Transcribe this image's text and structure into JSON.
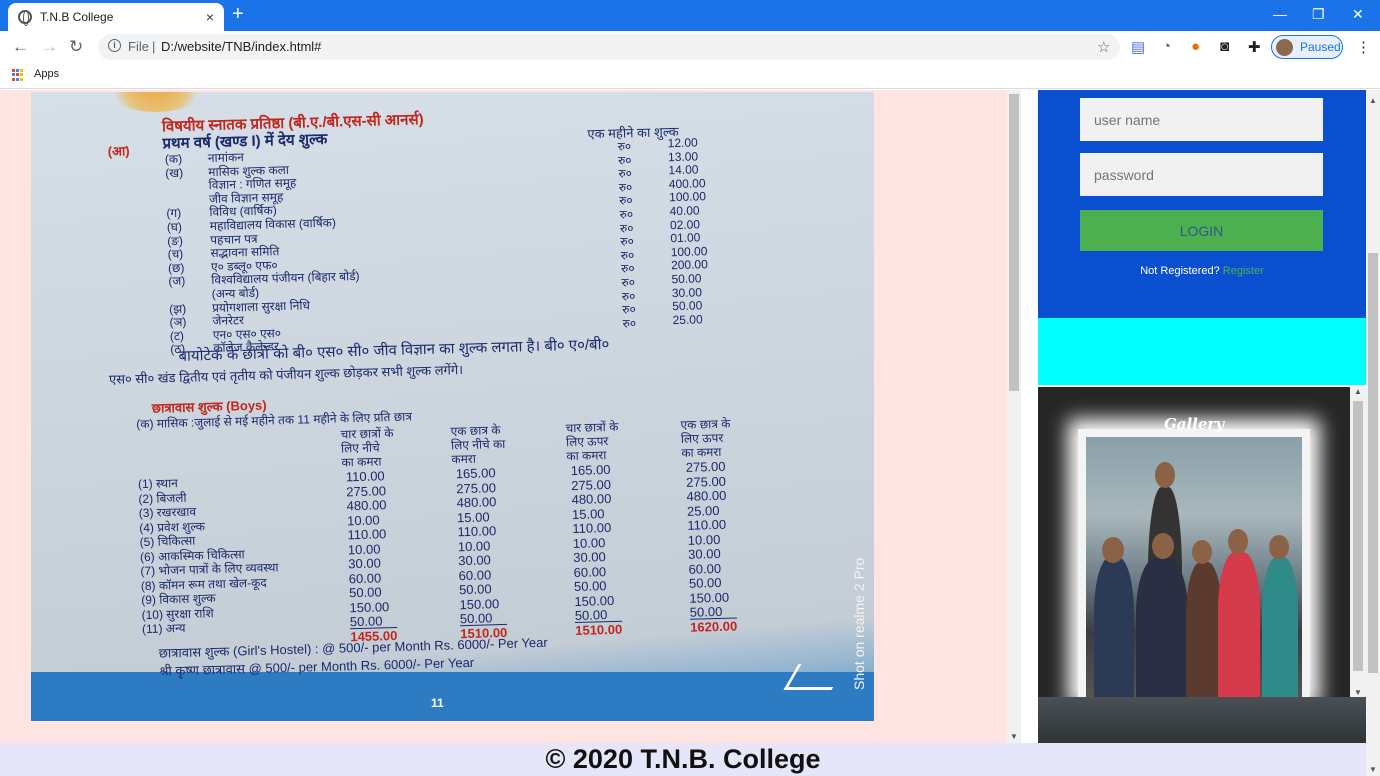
{
  "browser": {
    "tab_title": "T.N.B College",
    "tab_close": "×",
    "new_tab": "+",
    "url_scheme": "File",
    "url": "D:/website/TNB/index.html#",
    "profile_status": "Paused",
    "bookmark_apps": "Apps",
    "min": "—",
    "restore": "❐",
    "close": "✕"
  },
  "login": {
    "username_placeholder": "user name",
    "password_placeholder": "password",
    "login_label": "LOGIN",
    "not_registered": "Not Registered?",
    "register_link": "Register"
  },
  "gallery": {
    "title": "Gallery"
  },
  "footer": {
    "copyright": "© 2020 T.N.B. College"
  },
  "document": {
    "heading_marker": "(आ)",
    "heading": "विषयीय स्नातक प्रतिष्ठा (बी.ए./बी.एस-सी आनर्स)",
    "subheading": "प्रथम वर्ष (खण्ड I) में देय शुल्क",
    "fee_col": "एक महीने का शुल्क",
    "fees": [
      {
        "m": "(क)",
        "l": "नामांकन",
        "c": "रु०",
        "v": "12.00"
      },
      {
        "m": "(ख)",
        "l": "मासिक शुल्क कला",
        "c": "रु०",
        "v": "13.00"
      },
      {
        "m": "",
        "l": "विज्ञान : गणित समूह",
        "c": "रु०",
        "v": "14.00"
      },
      {
        "m": "",
        "l": "जीव विज्ञान समूह",
        "c": "रु०",
        "v": "400.00"
      },
      {
        "m": "(ग)",
        "l": "विविध (वार्षिक)",
        "c": "रु०",
        "v": "100.00"
      },
      {
        "m": "(घ)",
        "l": "महाविद्यालय विकास (वार्षिक)",
        "c": "रु०",
        "v": "40.00"
      },
      {
        "m": "(ङ)",
        "l": "पहचान पत्र",
        "c": "रु०",
        "v": "02.00"
      },
      {
        "m": "(च)",
        "l": "सद्भावना समिति",
        "c": "रु०",
        "v": "01.00"
      },
      {
        "m": "(छ)",
        "l": "ए० डब्लू० एफ०",
        "c": "रु०",
        "v": "100.00"
      },
      {
        "m": "(ज)",
        "l": "विश्वविद्यालय पंजीयन (बिहार बोर्ड)",
        "c": "रु०",
        "v": "200.00"
      },
      {
        "m": "",
        "l": "(अन्य बोर्ड)",
        "c": "रु०",
        "v": "50.00"
      },
      {
        "m": "(झ)",
        "l": "प्रयोगशाला सुरक्षा निधि",
        "c": "रु०",
        "v": "30.00"
      },
      {
        "m": "(ञ)",
        "l": "जेनरेटर",
        "c": "रु०",
        "v": "50.00"
      },
      {
        "m": "(ट)",
        "l": "एन० एस० एस०",
        "c": "रु०",
        "v": "25.00"
      },
      {
        "m": "(ठ)",
        "l": "कॉलेज कैलेन्डर",
        "c": "",
        "v": ""
      }
    ],
    "note1": "बायोटेक के छात्रों को बी० एस० सी० जीव विज्ञान का शुल्क लगता है। बी० ए०/बी०",
    "note2": "एस० सी० खंड द्वितीय एवं तृतीय को पंजीयन शुल्क छोड़कर सभी शुल्क लगेंगे।",
    "hostel_title": "छात्रावास शुल्क (Boys)",
    "hostel_sub": "(क) मासिक :जुलाई से मई महीने तक 11 महीने के लिए प्रति छात्र",
    "hostel_cols": [
      [
        "चार छात्रों के",
        "लिए नीचे",
        "का कमरा"
      ],
      [
        "एक छात्र के",
        "लिए नीचे का",
        "कमरा"
      ],
      [
        "चार छात्रों के",
        "लिए ऊपर",
        "का कमरा"
      ],
      [
        "एक छात्र के",
        "लिए ऊपर",
        "का कमरा"
      ]
    ],
    "hostel_rows": [
      {
        "l": "(1) स्थान",
        "v": [
          "110.00",
          "165.00",
          "165.00",
          "275.00"
        ]
      },
      {
        "l": "(2) बिजली",
        "v": [
          "275.00",
          "275.00",
          "275.00",
          "275.00"
        ]
      },
      {
        "l": "(3) रखरखाव",
        "v": [
          "480.00",
          "480.00",
          "480.00",
          "480.00"
        ]
      },
      {
        "l": "(4) प्रवेश शुल्क",
        "v": [
          "10.00",
          "15.00",
          "15.00",
          "25.00"
        ]
      },
      {
        "l": "(5) चिकित्सा",
        "v": [
          "110.00",
          "110.00",
          "110.00",
          "110.00"
        ]
      },
      {
        "l": "(6) आकस्मिक चिकित्सा",
        "v": [
          "10.00",
          "10.00",
          "10.00",
          "10.00"
        ]
      },
      {
        "l": "(7) भोजन पात्रों के लिए व्यवस्था",
        "v": [
          "30.00",
          "30.00",
          "30.00",
          "30.00"
        ]
      },
      {
        "l": "(8) कॉमन रूम तथा खेल-कूद",
        "v": [
          "60.00",
          "60.00",
          "60.00",
          "60.00"
        ]
      },
      {
        "l": "(9) विकास शुल्क",
        "v": [
          "50.00",
          "50.00",
          "50.00",
          "50.00"
        ]
      },
      {
        "l": "(10) सुरक्षा राशि",
        "v": [
          "150.00",
          "150.00",
          "150.00",
          "150.00"
        ]
      },
      {
        "l": "(11) अन्य",
        "v": [
          "50.00",
          "50.00",
          "50.00",
          "50.00"
        ]
      }
    ],
    "totals": [
      "1455.00",
      "1510.00",
      "1510.00",
      "1620.00"
    ],
    "girls_hostel": "छात्रावास शुल्क (Girl's Hostel) : @ 500/- per Month   Rs. 6000/- Per Year",
    "krishna_hostel": "श्री कृष्ण छात्रावास @ 500/- per Month   Rs. 6000/- Per Year",
    "page_number": "11",
    "watermark": "Shot on realme 2 Pro"
  }
}
